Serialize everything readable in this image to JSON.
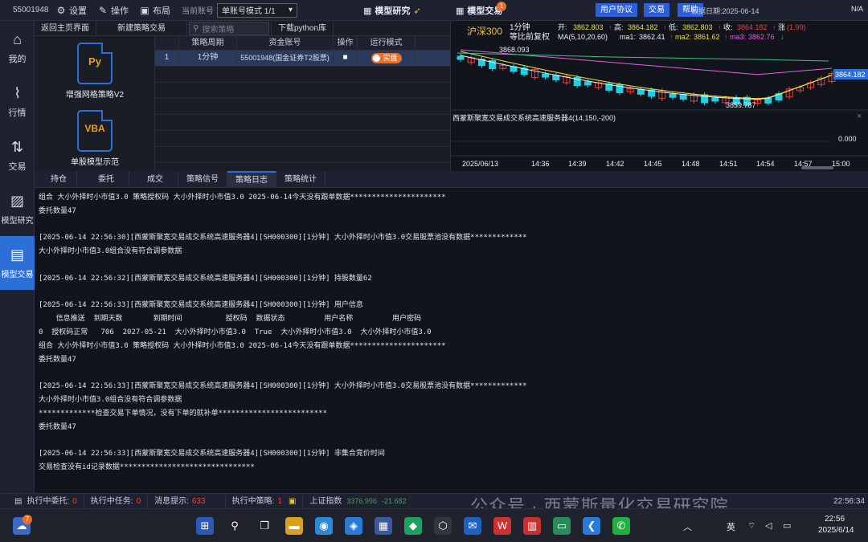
{
  "topbar": {
    "account": "55001948",
    "settings": "设置",
    "operation": "操作",
    "layout": "布局",
    "current_account_label": "当前账号",
    "account_mode": "单账号模式 1/1",
    "center_tab_research": "模型研究",
    "center_tab_trading": "模型交易",
    "trading_badge": "1",
    "btn_user_agreement": "用户协议",
    "btn_trade": "交易",
    "btn_help": "帮助",
    "right_info": "数据日期:2025-06-14",
    "right_status": "N/A"
  },
  "sidebar": {
    "items": [
      {
        "label": "我的",
        "icon": "home-icon"
      },
      {
        "label": "行情",
        "icon": "chart-icon"
      },
      {
        "label": "交易",
        "icon": "trade-icon"
      },
      {
        "label": "模型研究",
        "icon": "research-icon"
      },
      {
        "label": "模型交易",
        "icon": "model-trade-icon"
      }
    ]
  },
  "strategy_bar": {
    "back_home": "返回主页界面",
    "new_strategy": "新建策略交易",
    "search_placeholder": "搜索策略",
    "download": "下载python库"
  },
  "models": [
    {
      "badge": "Py",
      "name": "增强网格策略V2"
    },
    {
      "badge": "VBA",
      "name": "单股模型示范"
    }
  ],
  "strategy_table": {
    "headers": [
      "",
      "策略周期",
      "资金账号",
      "操作",
      "运行模式"
    ],
    "rows": [
      {
        "index": "1",
        "period": "1分钟",
        "account": "55001948(国金证券T2股票)",
        "op": "■",
        "mode": "实盘"
      }
    ]
  },
  "chart": {
    "symbol": "沪深300",
    "period": "1分钟",
    "adjust": "等比前复权",
    "open_label": "开:",
    "open": "3862.803",
    "high_label": "高:",
    "high": "3864.182",
    "low_label": "低:",
    "low": "3862.803",
    "close_label": "收:",
    "close": "3864.182",
    "change_label": "涨",
    "change": "(1.99)",
    "ma_label": "MA(5,10,20,60)",
    "ma1_label": "ma1:",
    "ma1": "3862.41",
    "ma2_label": "ma2:",
    "ma2": "3861.62",
    "ma3_label": "ma3:",
    "ma3": "3862.76",
    "price_high_label": "3868.093",
    "price_low_label": "3859.787",
    "price_current": "3864.182",
    "indicator_title": "西蒙斯聚宽交易成交系统高速服务器4(14,150,-200)",
    "indicator_zero": "0.000",
    "x_labels": [
      "2025/06/13",
      "14:36",
      "14:39",
      "14:42",
      "14:45",
      "14:48",
      "14:51",
      "14:54",
      "14:57",
      "15:00"
    ]
  },
  "chart_colors": {
    "up": "#e84040",
    "down": "#20d0e0",
    "ma1": "#f0f0f0",
    "ma2": "#e8e040",
    "ma3": "#e060e0",
    "ma4": "#40c080"
  },
  "tabs": [
    "持仓",
    "委托",
    "成交",
    "策略信号",
    "策略日志",
    "策略统计"
  ],
  "active_tab": "策略日志",
  "log_lines": [
    "组合 大小外择时小市值3.0 策略授权码 大小外择时小市值3.0 2025-06-14今天没有跟单数据**********************",
    "委托数量47",
    "",
    "[2025-06-14 22:56:30][西蒙斯聚宽交易成交系统高速服务器4][SH000300][1分钟] 大小外择时小市值3.0交易股票池没有数据*************",
    "大小外择时小市值3.0组合没有符合调参数据",
    "",
    "[2025-06-14 22:56:32][西蒙斯聚宽交易成交系统高速服务器4][SH000300][1分钟] 持股数量62",
    "",
    "[2025-06-14 22:56:33][西蒙斯聚宽交易成交系统高速服务器4][SH000300][1分钟] 用户信息",
    "    信息推送  到期天数       到期时间          授权码  数据状态         用户名称         用户密码",
    "0  授权码正常   706  2027-05-21  大小外择时小市值3.0  True  大小外择时小市值3.0  大小外择时小市值3.0",
    "组合 大小外择时小市值3.0 策略授权码 大小外择时小市值3.0 2025-06-14今天没有跟单数据**********************",
    "委托数量47",
    "",
    "[2025-06-14 22:56:33][西蒙斯聚宽交易成交系统高速服务器4][SH000300][1分钟] 大小外择时小市值3.0交易股票池没有数据*************",
    "大小外择时小市值3.0组合没有符合调参数据",
    "*************检查交易下单情况，没有下单的就补单*************************",
    "委托数量47",
    "",
    "[2025-06-14 22:56:33][西蒙斯聚宽交易成交系统高速服务器4][SH000300][1分钟] 非集合竞价时间",
    "交易检查没有id记录数据*******************************"
  ],
  "statusbar": {
    "exec_orders_label": "执行中委托:",
    "exec_orders": "0",
    "exec_tasks_label": "执行中任务:",
    "exec_tasks": "0",
    "messages_label": "消息提示:",
    "messages": "633",
    "exec_strategies_label": "执行中策略:",
    "exec_strategies": "1",
    "index_label": "上证指数",
    "index_value": "3376.996",
    "index_change": "-21.682",
    "time": "22:56:34"
  },
  "watermark": "公众号 · 西蒙斯量化交易研究院",
  "taskbar": {
    "weather_badge": "7",
    "tray_lang": "英",
    "time": "22:56",
    "date": "2025/6/14"
  }
}
